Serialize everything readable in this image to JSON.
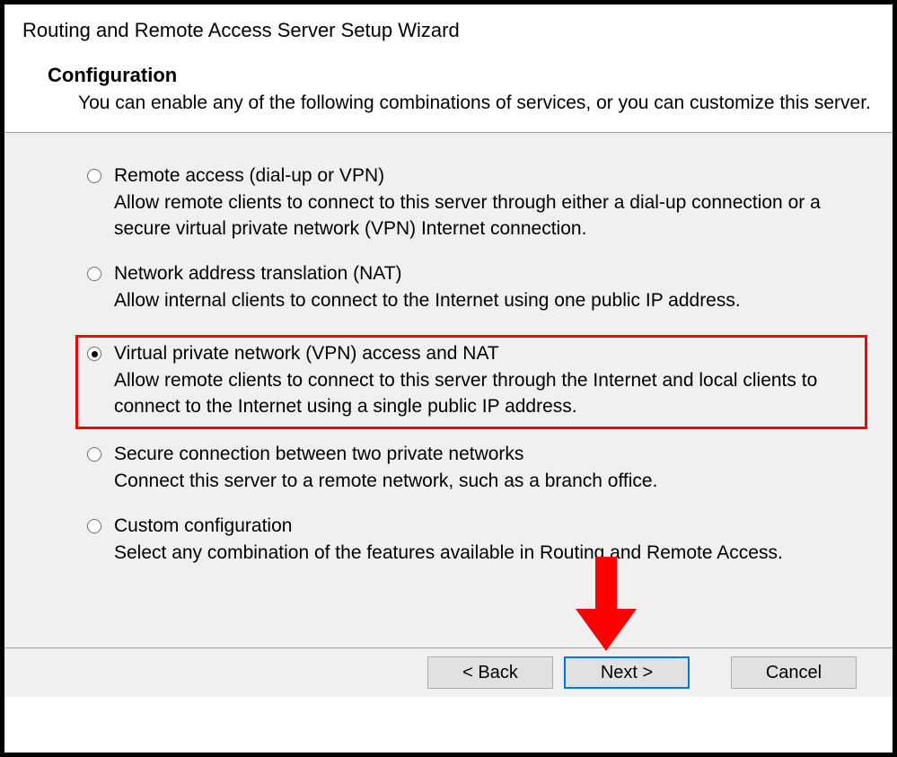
{
  "window": {
    "title": "Routing and Remote Access Server Setup Wizard"
  },
  "header": {
    "heading": "Configuration",
    "subtext": "You can enable any of the following combinations of services, or you can customize this server."
  },
  "options": [
    {
      "label": "Remote access (dial-up or VPN)",
      "description": "Allow remote clients to connect to this server through either a dial-up connection or a secure virtual private network (VPN) Internet connection.",
      "selected": false,
      "highlighted": false
    },
    {
      "label": "Network address translation (NAT)",
      "description": "Allow internal clients to connect to the Internet using one public IP address.",
      "selected": false,
      "highlighted": false
    },
    {
      "label": "Virtual private network (VPN) access and NAT",
      "description": "Allow remote clients to connect to this server through the Internet and local clients to connect to the Internet using a single public IP address.",
      "selected": true,
      "highlighted": true
    },
    {
      "label": "Secure connection between two private networks",
      "description": "Connect this server to a remote network, such as a branch office.",
      "selected": false,
      "highlighted": false
    },
    {
      "label": "Custom configuration",
      "description": "Select any combination of the features available in Routing and Remote Access.",
      "selected": false,
      "highlighted": false
    }
  ],
  "buttons": {
    "back": "< Back",
    "next": "Next >",
    "cancel": "Cancel"
  },
  "annotation": {
    "arrow_color": "#ff0000",
    "highlight_color": "#ff0000"
  }
}
